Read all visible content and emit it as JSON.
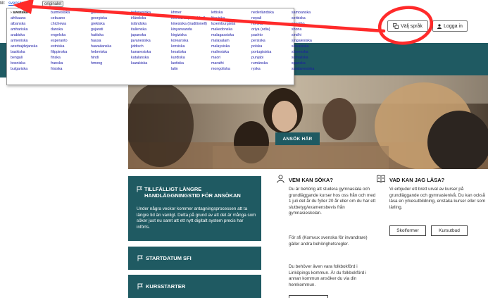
{
  "translate_bar": {
    "label": "till:",
    "current_language": "svenska",
    "original_button": "originalet"
  },
  "language_menu": {
    "languages": [
      "› svenska",
      "afrikaans",
      "albanska",
      "amhariska",
      "arabiska",
      "armeniska",
      "azerbajdzjanska",
      "baskiska",
      "bengali",
      "bosniska",
      "bulgariska",
      "",
      "",
      "burmesiska",
      "cebuano",
      "chichewa",
      "danska",
      "engelska",
      "esperanto",
      "estniska",
      "filippinska",
      "finska",
      "franska",
      "frisiska",
      "",
      "",
      "galiciska",
      "georgiska",
      "grekiska",
      "gujarati",
      "haitiska",
      "hausa",
      "hawaiianska",
      "hebreiska",
      "hindi",
      "hmong",
      "",
      "",
      "",
      "indonesiska",
      "irländska",
      "isländska",
      "italienska",
      "japanska",
      "javanesiska",
      "jiddisch",
      "kanaresiska",
      "katalanska",
      "kazakiska",
      "",
      "",
      "",
      "khmer",
      "kinesiska (förenklad)",
      "kinesiska (traditionell)",
      "kinyarwanda",
      "kirgiziska",
      "koreanska",
      "korsiska",
      "kroatiska",
      "kurdiska",
      "laotiska",
      "latin",
      "",
      "",
      "lettiska",
      "litauiska",
      "luxemburgiska",
      "makedonska",
      "malagassiska",
      "malayalam",
      "malaysiska",
      "maltesiska",
      "maori",
      "marathi",
      "mongoliska",
      "",
      "",
      "nederländska",
      "nepali",
      "norska",
      "oriya (odia)",
      "pashto",
      "persiska",
      "polska",
      "portugisiska",
      "punjabi",
      "rumänska",
      "ryska",
      "",
      "",
      "samoanska",
      "serbiska",
      "sesotho",
      "shona",
      "sindhi",
      "singalesiska",
      "slovakiska",
      "slovenska",
      "somaliska",
      "spanska",
      "sundanesiska",
      "",
      "",
      "swahili",
      "tadzjikiska",
      "tamil",
      "tatariska",
      "telugu",
      "thailändska",
      "tjeckiska",
      "turkiska",
      "turkmeniska",
      "tyska",
      "uiguriska",
      "",
      "",
      "ukrainska",
      "ungerska",
      "",
      "uzbekiska",
      "vietnamesiska",
      "vitryska",
      "walesiska",
      "xhosa",
      "yoruba",
      "zulu",
      "",
      "",
      ""
    ]
  },
  "header": {
    "lang_button": "Välj språk",
    "login_button": "Logga in",
    "nav_item": "A"
  },
  "hero": {
    "apply_button": "ANSÖK HÄR"
  },
  "cards": {
    "card1_title": "TILLFÄLLIGT LÄNGRE HANDLÄGGNINGSTID FÖR ANSÖKAN",
    "card1_body": "Under några veckor kommer antagningsprocessen att ta längre tid än vanligt. Detta på grund av att det är många som söker just nu samt att ett nytt digitalt system precis har införts.",
    "card2_title": "STARTDATUM SFI",
    "card3_title": "KURSSTARTER"
  },
  "col1": {
    "title": "VEM KAN SÖKA?",
    "p1": "Du är behörig att studera gymnasiala och grundläggande kurser hos oss från och med 1 juli det år du fyller 20 år eller om du har ett slutbetyg/examensbevis från gymnasieskolan.",
    "p2": "För sfi (Komvux svenska för invandrare) gäller andra behörighetsregler.",
    "p3": "Du behöver även vara folkbokförd i Linköpings kommun. Är du folkbokförd i annan kommun ansöker du via din hemkommun."
  },
  "col2": {
    "title": "VAD KAN JAG LÄSA?",
    "p1": "Vi erbjuder ett brett urval av kurser på grundläggande och gymnasienivå. Du kan också läsa en yrkesutbildning, enstaka kurser eller som lärling.",
    "btn_skol": "Skolformer",
    "btn_kurs": "Kursutbud"
  },
  "colors": {
    "teal": "#1f5a62",
    "link_blue": "#1a1aa6",
    "annotation_red": "#ff2a2a"
  }
}
